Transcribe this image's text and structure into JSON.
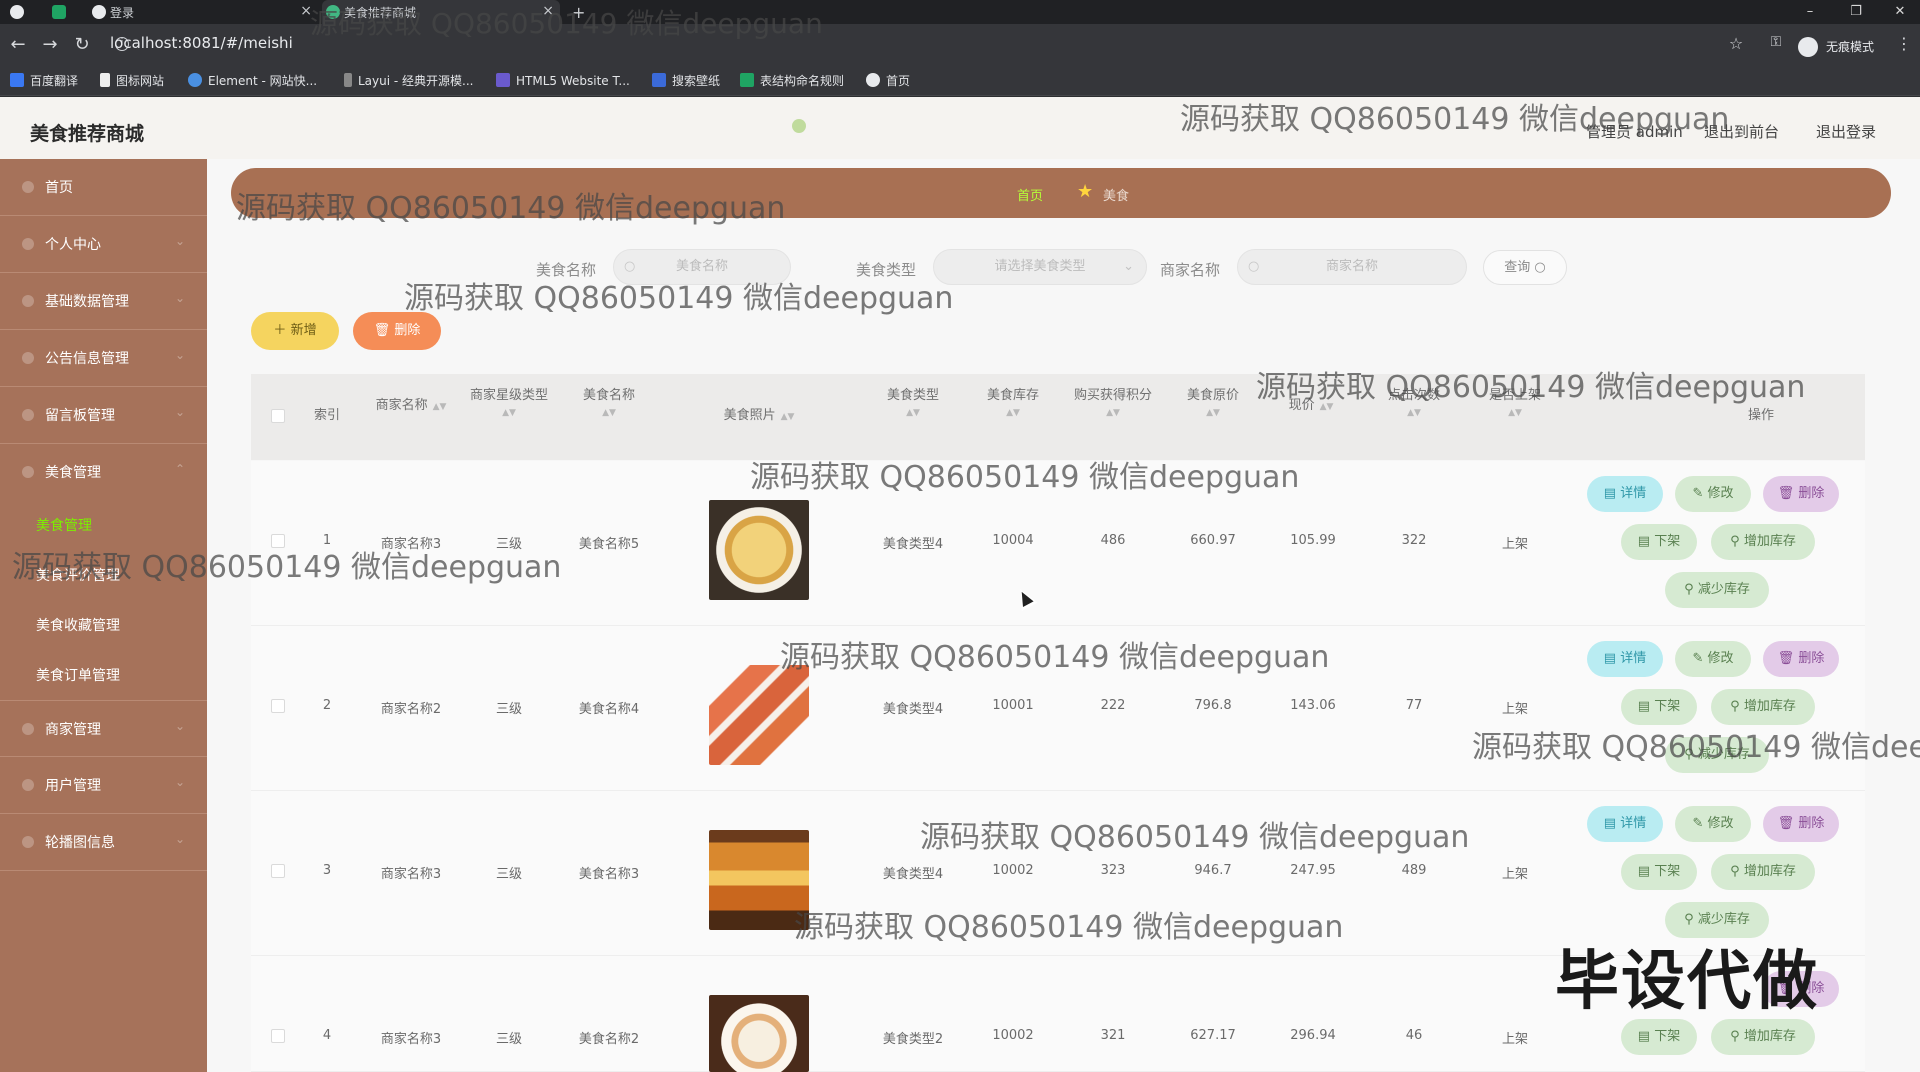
{
  "browser": {
    "tabs": [
      {
        "label": ""
      },
      {
        "label": ""
      },
      {
        "label": "登录"
      },
      {
        "label": "美食推荐商城"
      }
    ],
    "new_tab_symbol": "+",
    "url": "localhost:8081/#/meishi",
    "incognito_label": "无痕模式",
    "bookmarks": [
      "百度翻译",
      "图标网站",
      "Element - 网站快...",
      "Layui - 经典开源模...",
      "HTML5 Website T...",
      "搜索壁纸",
      "表结构命名规则",
      "首页"
    ]
  },
  "header": {
    "brand": "美食推荐商城",
    "user_label": "管理员 admin",
    "back_front": "退出到前台",
    "logout": "退出登录"
  },
  "sidebar": {
    "items": [
      {
        "label": "首页"
      },
      {
        "label": "个人中心"
      },
      {
        "label": "基础数据管理"
      },
      {
        "label": "公告信息管理"
      },
      {
        "label": "留言板管理"
      },
      {
        "label": "美食管理"
      },
      {
        "label": "商家管理"
      },
      {
        "label": "用户管理"
      },
      {
        "label": "轮播图信息"
      }
    ],
    "sub_items": [
      {
        "label": "美食管理",
        "active": true
      },
      {
        "label": "美食评价管理",
        "active": false
      },
      {
        "label": "美食收藏管理",
        "active": false
      },
      {
        "label": "美食订单管理",
        "active": false
      }
    ]
  },
  "breadcrumb": {
    "home": "首页",
    "current": "美食"
  },
  "search": {
    "name_label": "美食名称",
    "name_placeholder": "美食名称",
    "type_label": "美食类型",
    "type_placeholder": "请选择美食类型",
    "merchant_label": "商家名称",
    "merchant_placeholder": "商家名称",
    "query_button": "查询"
  },
  "actions": {
    "add": "新增",
    "delete": "删除"
  },
  "table": {
    "columns": [
      "索引",
      "商家名称",
      "商家星级类型",
      "美食名称",
      "美食照片",
      "美食类型",
      "美食库存",
      "购买获得积分",
      "美食原价",
      "现价",
      "点击次数",
      "是否上架",
      "操作"
    ],
    "rows": [
      {
        "index": "1",
        "merchant": "商家名称3",
        "star": "三级",
        "name": "美食名称5",
        "type": "美食类型4",
        "stock": "10004",
        "points": "486",
        "orig_price": "660.97",
        "price": "105.99",
        "clicks": "322",
        "status": "上架"
      },
      {
        "index": "2",
        "merchant": "商家名称2",
        "star": "三级",
        "name": "美食名称4",
        "type": "美食类型4",
        "stock": "10001",
        "points": "222",
        "orig_price": "796.8",
        "price": "143.06",
        "clicks": "77",
        "status": "上架"
      },
      {
        "index": "3",
        "merchant": "商家名称3",
        "star": "三级",
        "name": "美食名称3",
        "type": "美食类型4",
        "stock": "10002",
        "points": "323",
        "orig_price": "946.7",
        "price": "247.95",
        "clicks": "489",
        "status": "上架"
      },
      {
        "index": "4",
        "merchant": "商家名称3",
        "star": "三级",
        "name": "美食名称2",
        "type": "美食类型2",
        "stock": "10002",
        "points": "321",
        "orig_price": "627.17",
        "price": "296.94",
        "clicks": "46",
        "status": "上架"
      }
    ],
    "op_labels": {
      "detail": "详情",
      "edit": "修改",
      "remove": "删除",
      "down": "下架",
      "add_stock": "增加库存",
      "reduce_stock": "减少库存"
    }
  },
  "watermark": {
    "text": "源码获取 QQ86050149 微信deepguan",
    "banner": "毕设代做"
  },
  "colors": {
    "sidebar": "#a6725a",
    "breadcrumb_bar": "#a87053",
    "active_green": "#7cf000",
    "add_button": "#f5d45f",
    "delete_button": "#f58d57"
  }
}
